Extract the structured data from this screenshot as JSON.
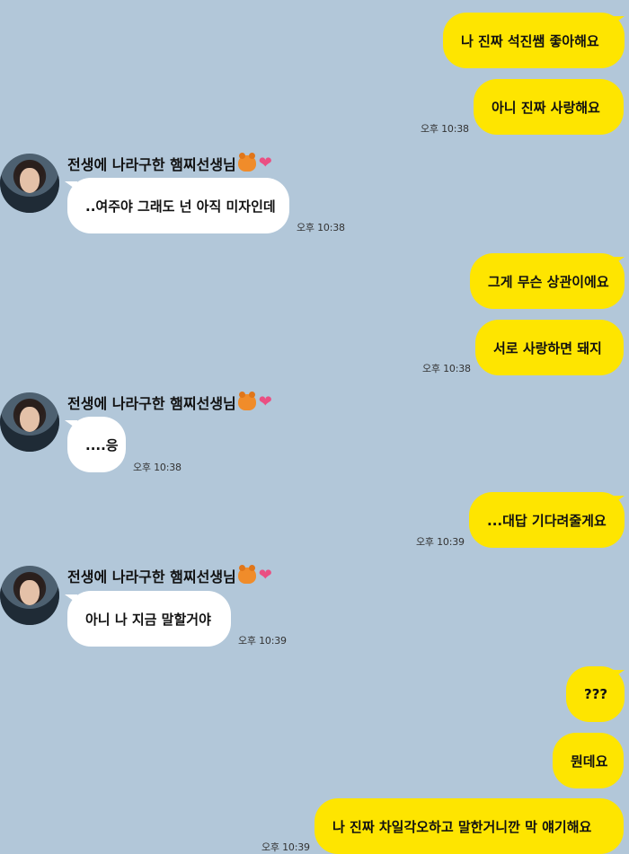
{
  "colors": {
    "background": "#b2c7d9",
    "my_bubble": "#fee500",
    "their_bubble": "#ffffff"
  },
  "contact": {
    "name": "전생에 나라구한 햄찌선생님",
    "name_icons": [
      "hamster-icon",
      "heart-icon"
    ],
    "heart": "❤"
  },
  "messages": [
    {
      "from": "me",
      "text": "나 진짜 석진쌤 좋아해요"
    },
    {
      "from": "me",
      "text": "아니 진짜 사랑해요",
      "time": "오후 10:38"
    },
    {
      "from": "them",
      "text": "..여주야 그래도 넌 아직 미자인데",
      "time": "오후 10:38"
    },
    {
      "from": "me",
      "text": "그게 무슨 상관이에요"
    },
    {
      "from": "me",
      "text": "서로 사랑하면 돼지",
      "time": "오후 10:38"
    },
    {
      "from": "them",
      "text": "....응",
      "time": "오후 10:38"
    },
    {
      "from": "me",
      "text": "...대답 기다려줄게요",
      "time": "오후 10:39"
    },
    {
      "from": "them",
      "text": "아니 나 지금 말할거야",
      "time": "오후 10:39"
    },
    {
      "from": "me",
      "text": "???"
    },
    {
      "from": "me",
      "text": "뭔데요"
    },
    {
      "from": "me",
      "text": "나 진짜 차일각오하고 말한거니깐 막 얘기해요",
      "time": "오후 10:39"
    }
  ]
}
